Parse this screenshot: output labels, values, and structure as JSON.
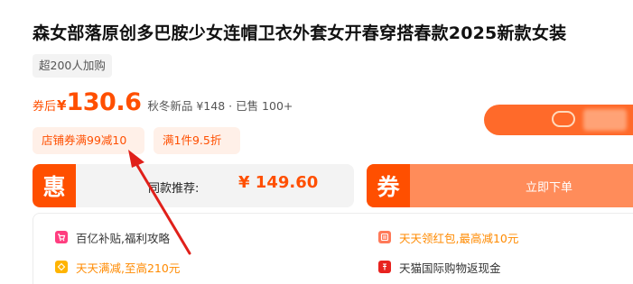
{
  "product": {
    "title": "森女部落原创多巴胺少女连帽卫衣外套女开春穿搭春款2025新款女装",
    "buyers_tag": "超200人加购"
  },
  "price": {
    "prefix": "券后",
    "currency": "¥",
    "value": "130.6",
    "note": "秋冬新品 ¥148 · 已售 100+"
  },
  "coupons": {
    "store": "店铺券满99减10",
    "discount": "满1件9.5折"
  },
  "similar": {
    "badge": "惠",
    "label": "同款推荐:",
    "price": "¥ 149.60"
  },
  "buy": {
    "badge": "券",
    "label": "立即下单"
  },
  "benefits": [
    {
      "text": "百亿补贴,福利攻略",
      "icon": "cart-icon"
    },
    {
      "text": "天天领红包,最高减10元",
      "icon": "red-packet-icon"
    },
    {
      "text": "天天满减,至高210元",
      "icon": "coupon-icon"
    },
    {
      "text": "天猫国际购物返现金",
      "icon": "cashback-icon"
    }
  ],
  "colors": {
    "accent": "#ff4f00",
    "buy_bg": "#ff8c5a",
    "coupon_bg": "#fff0e8",
    "arrow": "#e0201a"
  }
}
